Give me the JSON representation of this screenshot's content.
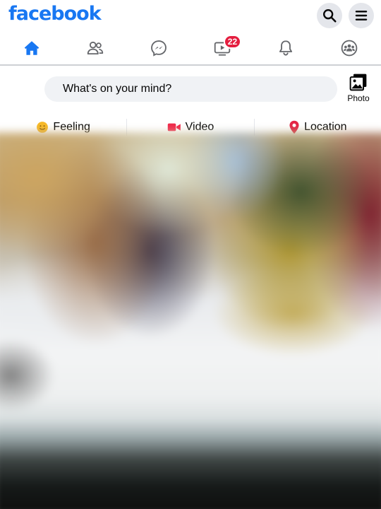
{
  "app": {
    "logo_text": "facebook",
    "brand_color": "#1877f2"
  },
  "header": {
    "search_icon": "search-icon",
    "menu_icon": "menu-icon"
  },
  "nav": {
    "tabs": [
      {
        "name": "home",
        "icon": "home-icon",
        "active": true
      },
      {
        "name": "friends",
        "icon": "friends-icon"
      },
      {
        "name": "messenger",
        "icon": "messenger-icon"
      },
      {
        "name": "watch",
        "icon": "watch-icon",
        "badge": "22"
      },
      {
        "name": "notifications",
        "icon": "bell-icon"
      },
      {
        "name": "groups",
        "icon": "groups-icon"
      }
    ],
    "badge_color": "#e41e3f"
  },
  "composer": {
    "placeholder": "What's on your mind?",
    "photo_label": "Photo"
  },
  "actions": {
    "feeling": "Feeling",
    "video": "Video",
    "location": "Location",
    "feeling_color": "#f7b928",
    "video_color": "#f02849",
    "location_color": "#e42645"
  }
}
